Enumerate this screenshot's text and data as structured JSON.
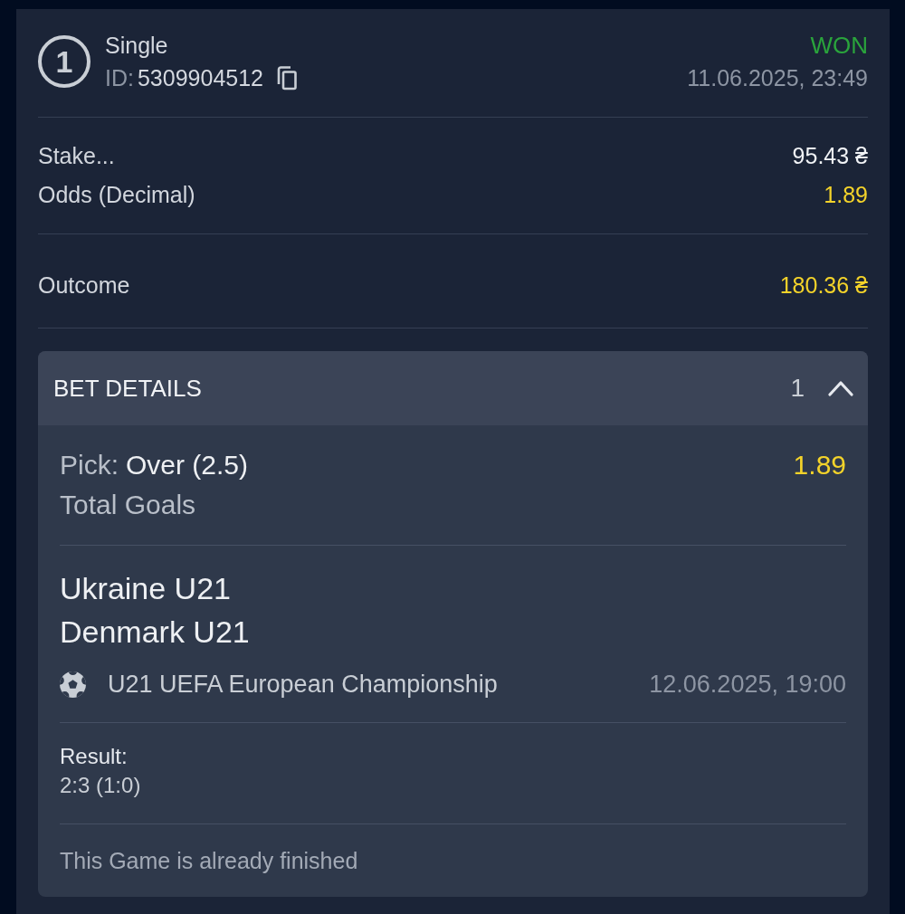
{
  "bet": {
    "number": "1",
    "type": "Single",
    "id_label": "ID:",
    "id": "5309904512",
    "status": "WON",
    "won": true,
    "placed_at": "11.06.2025, 23:49"
  },
  "summary": [
    {
      "label": "Stake...",
      "value": "95.43 ₴",
      "highlight": false
    },
    {
      "label": "Odds (Decimal)",
      "value": "1.89",
      "highlight": true
    }
  ],
  "outcome": {
    "label": "Outcome",
    "value": "180.36 ₴"
  },
  "details": {
    "title": "BET DETAILS",
    "count": "1",
    "expanded": true,
    "pick_label": "Pick:",
    "pick": "Over (2.5)",
    "odds": "1.89",
    "market": "Total Goals",
    "teams": [
      "Ukraine U21",
      "Denmark U21"
    ],
    "tournament": "U21 UEFA European Championship",
    "start": "12.06.2025, 19:00",
    "result_label": "Result:",
    "result": "2:3 (1:0)",
    "note": "This Game is already finished"
  }
}
